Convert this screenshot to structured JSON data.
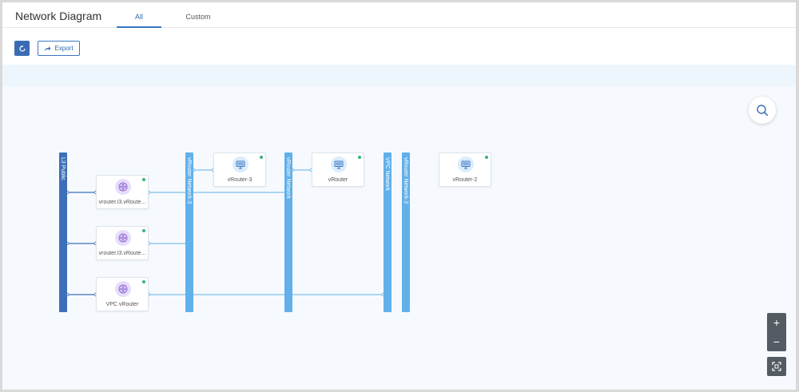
{
  "header": {
    "title": "Network Diagram",
    "tabs": [
      {
        "label": "All",
        "active": true
      },
      {
        "label": "Custom",
        "active": false
      }
    ]
  },
  "toolbar": {
    "refresh_icon": "refresh-icon",
    "export_label": "Export",
    "export_icon": "share-arrow-icon"
  },
  "networks": [
    {
      "label": "L3 Public",
      "style": "dark"
    },
    {
      "label": "vRouter Network-3",
      "style": "light"
    },
    {
      "label": "vRouter Network",
      "style": "light"
    },
    {
      "label": "VPC Network",
      "style": "light"
    },
    {
      "label": "vRouter Network-2",
      "style": "light"
    }
  ],
  "nodes": [
    {
      "label": "vrouter.l3.vRoute...",
      "icon": "vrouter-icon",
      "status": "running"
    },
    {
      "label": "vrouter.l3.vRoute...",
      "icon": "vrouter-icon",
      "status": "running"
    },
    {
      "label": "VPC vRouter",
      "icon": "vrouter-icon",
      "status": "running"
    },
    {
      "label": "vRouter-3",
      "icon": "monitor-icon",
      "status": "running"
    },
    {
      "label": "vRouter",
      "icon": "monitor-icon",
      "status": "running"
    },
    {
      "label": "vRouter-2",
      "icon": "monitor-icon",
      "status": "running"
    }
  ],
  "controls": {
    "zoom_in": "+",
    "zoom_out": "−",
    "fit_icon": "fit-screen-icon",
    "search_icon": "search-icon"
  },
  "colors": {
    "primary": "#3a6cb5",
    "network_dark": "#3d6fb6",
    "network_light": "#62b0ea",
    "status_running": "#37b37e"
  }
}
